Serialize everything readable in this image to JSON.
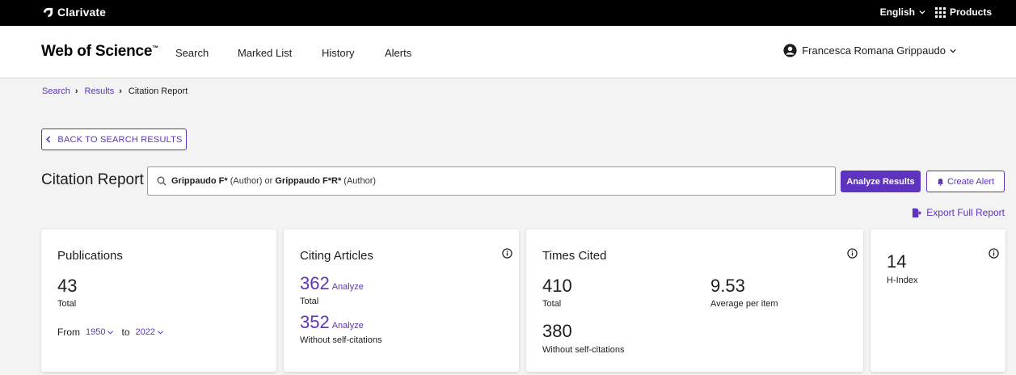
{
  "topbar": {
    "brand": "Clarivate",
    "language": "English",
    "products": "Products"
  },
  "nav": {
    "logo": "Web of Science",
    "logo_mark": "™",
    "items": [
      "Search",
      "Marked List",
      "History",
      "Alerts"
    ],
    "user": "Francesca Romana Grippaudo"
  },
  "breadcrumb": {
    "items": [
      "Search",
      "Results"
    ],
    "current": "Citation Report"
  },
  "back_button": "BACK TO SEARCH RESULTS",
  "report": {
    "title": "Citation Report",
    "query": {
      "term1": "Grippaudo F*",
      "field1": " (Author) or ",
      "term2": "Grippaudo F*R*",
      "field2": " (Author)"
    },
    "analyze_button": "Analyze Results",
    "alert_button": "Create Alert",
    "export": "Export Full Report"
  },
  "cards": {
    "publications": {
      "title": "Publications",
      "total": "43",
      "total_label": "Total",
      "from_label": "From",
      "from_year": "1950",
      "to_label": "to",
      "to_year": "2022"
    },
    "citing": {
      "title": "Citing Articles",
      "total": "362",
      "total_label": "Total",
      "without": "352",
      "without_label": "Without self-citations",
      "analyze": "Analyze"
    },
    "times_cited": {
      "title": "Times Cited",
      "total": "410",
      "total_label": "Total",
      "average": "9.53",
      "average_label": "Average per item",
      "without": "380",
      "without_label": "Without self-citations"
    },
    "hindex": {
      "value": "14",
      "label": "H-Index"
    }
  },
  "colors": {
    "accent": "#5e33bf",
    "topbar": "#000000",
    "background": "#f3f3f3"
  }
}
